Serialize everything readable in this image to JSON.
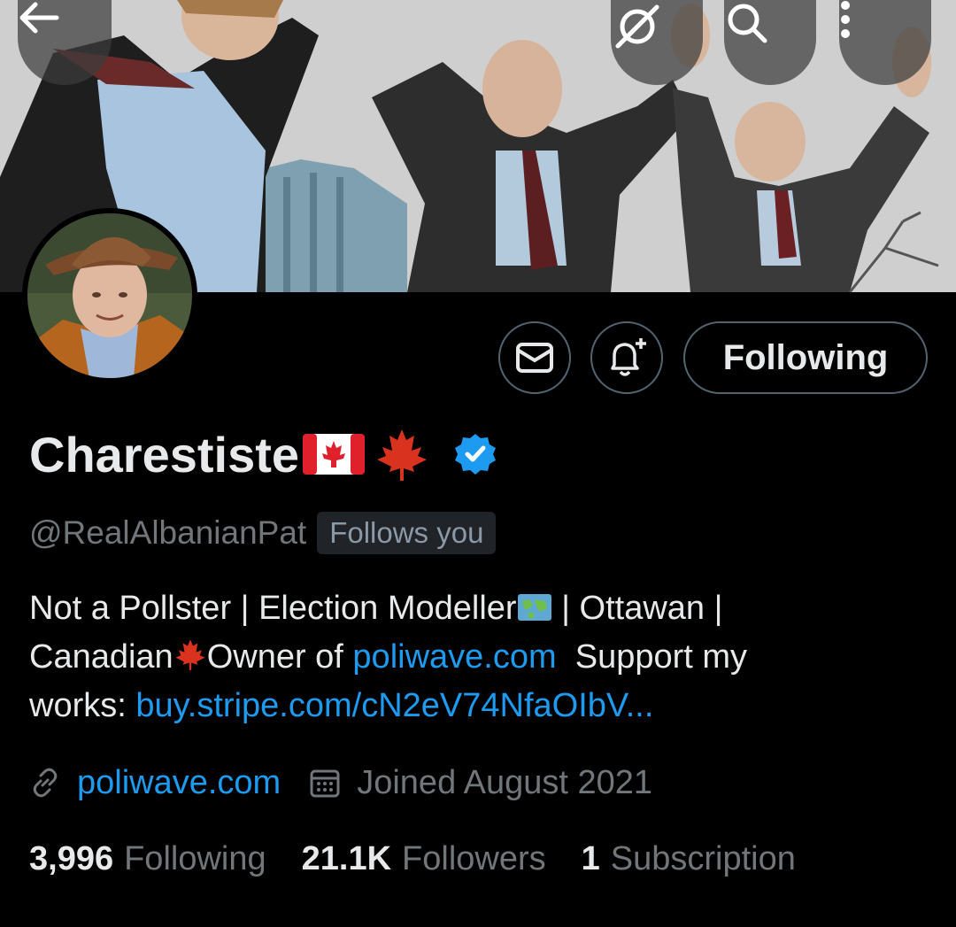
{
  "header": {
    "back_icon": "arrow-left-icon",
    "grok_icon": "grok-slash-icon",
    "search_icon": "search-icon",
    "more_icon": "more-vertical-icon"
  },
  "profile": {
    "display_name": "Charestiste",
    "handle": "@RealAlbanianPat",
    "follows_you": "Follows you",
    "verified": true,
    "name_emojis": [
      "canada-flag",
      "maple-leaf"
    ]
  },
  "actions": {
    "message_icon": "mail-icon",
    "notify_icon": "bell-plus-icon",
    "following_label": "Following"
  },
  "bio": {
    "line1_a": "Not a Pollster | Election Modeller",
    "line1_b": " | Ottawan |",
    "line2_a": "Canadian",
    "line2_b": "Owner of ",
    "line2_link": "poliwave.com",
    "line2_c": "  Support my",
    "line3_a": "works: ",
    "line3_link": "buy.stripe.com/cN2eV74NfaOIbV..."
  },
  "meta": {
    "website": "poliwave.com",
    "joined": "Joined August 2021"
  },
  "stats": {
    "following_count": "3,996",
    "following_label": "Following",
    "followers_count": "21.1K",
    "followers_label": "Followers",
    "subscription_count": "1",
    "subscription_label": "Subscription"
  },
  "colors": {
    "background": "#000000",
    "text": "#e7e9ea",
    "muted": "#71767b",
    "link": "#1d9bf0",
    "border": "#536471",
    "verified": "#1d9bf0"
  }
}
